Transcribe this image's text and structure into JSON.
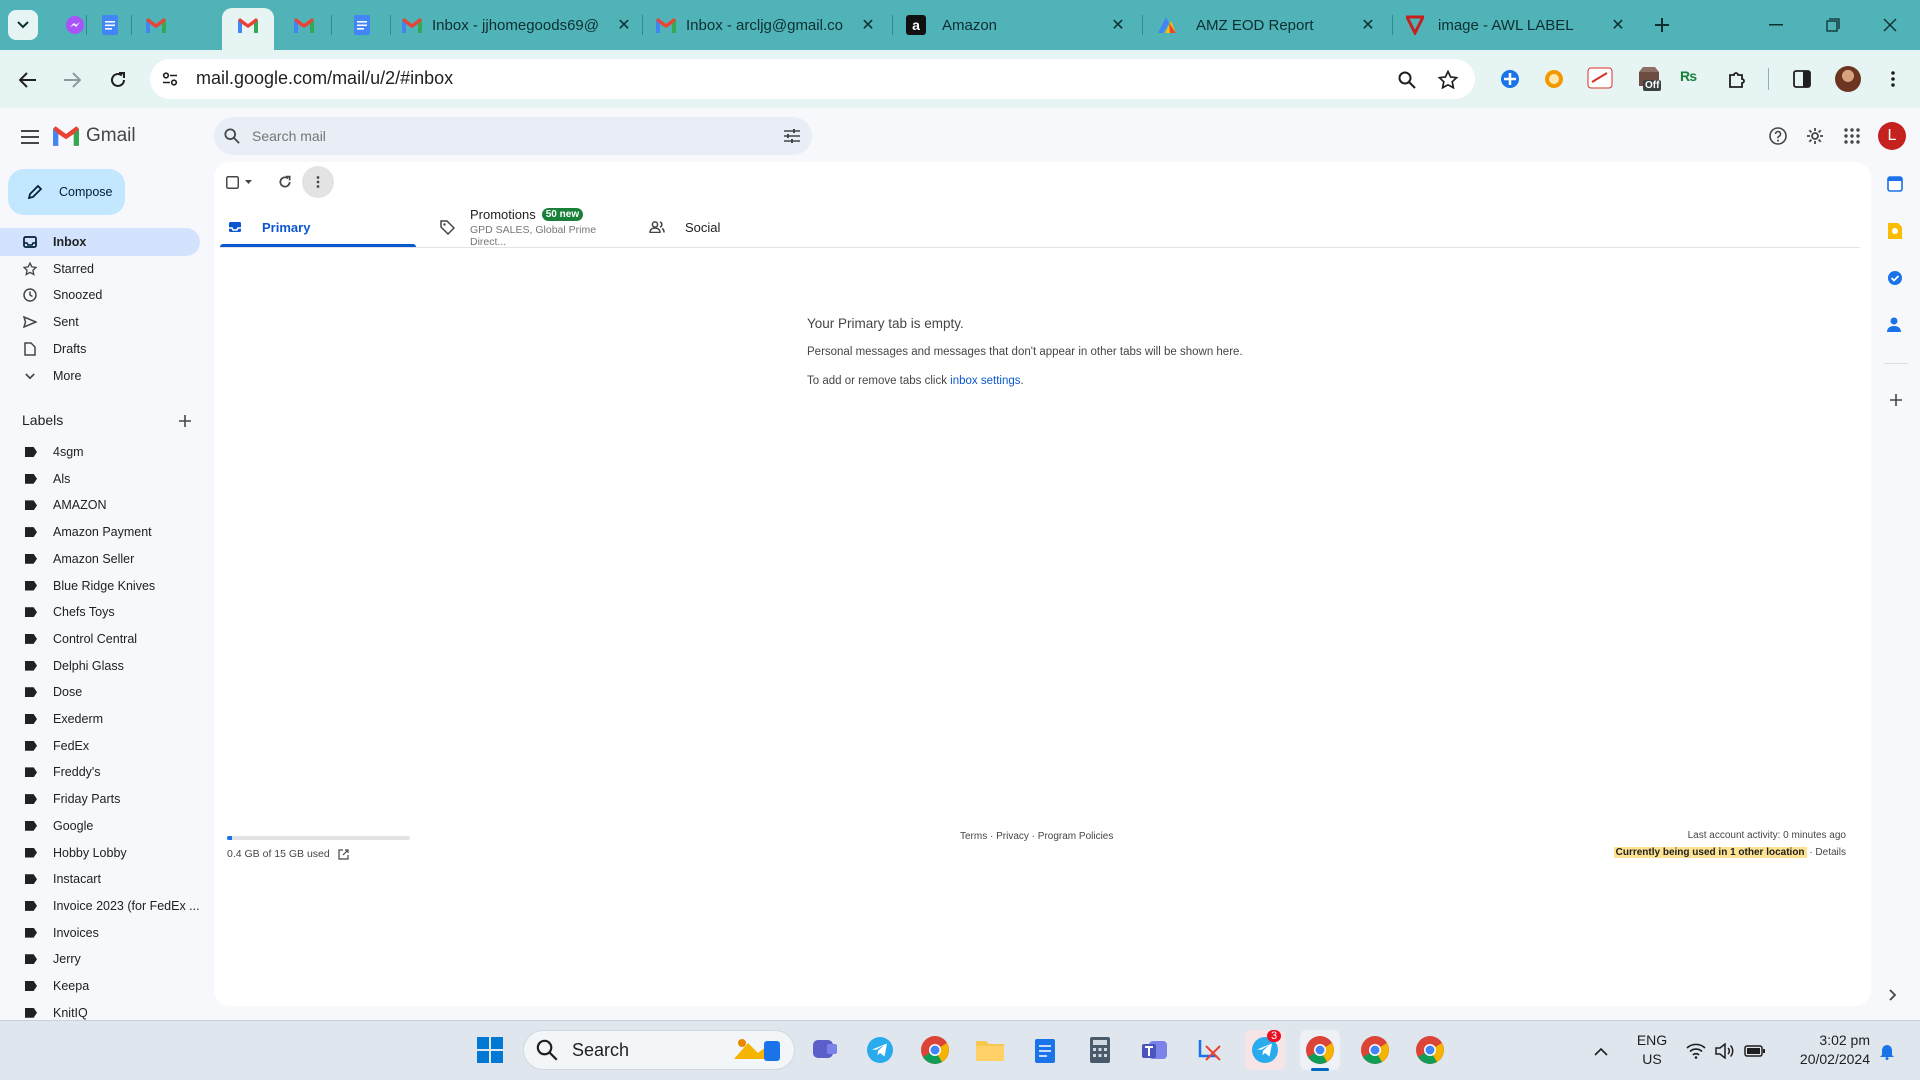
{
  "browser": {
    "tabs": [
      {
        "title": "Inbox - jjhomegoods69@",
        "icon": "gmail-icon"
      },
      {
        "title": "Inbox - arcljg@gmail.co",
        "icon": "gmail-icon"
      },
      {
        "title": "Amazon",
        "icon": "amazon-icon"
      },
      {
        "title": "AMZ EOD Report",
        "icon": "report-icon"
      },
      {
        "title": "image - AWL LABEL",
        "icon": "awl-icon"
      }
    ],
    "url": "mail.google.com/mail/u/2/#inbox",
    "extension_badge": "Off"
  },
  "gmail": {
    "app_name": "Gmail",
    "search_placeholder": "Search mail",
    "compose_label": "Compose",
    "account_initial": "L",
    "nav": [
      {
        "label": "Inbox",
        "icon": "inbox-icon"
      },
      {
        "label": "Starred",
        "icon": "star-icon"
      },
      {
        "label": "Snoozed",
        "icon": "clock-icon"
      },
      {
        "label": "Sent",
        "icon": "send-icon"
      },
      {
        "label": "Drafts",
        "icon": "draft-icon"
      },
      {
        "label": "More",
        "icon": "chevron-down-icon"
      }
    ],
    "labels_heading": "Labels",
    "labels": [
      "4sgm",
      "Als",
      "AMAZON",
      "Amazon Payment",
      "Amazon Seller",
      "Blue Ridge Knives",
      "Chefs Toys",
      "Control Central",
      "Delphi Glass",
      "Dose",
      "Exederm",
      "FedEx",
      "Freddy's",
      "Friday Parts",
      "Google",
      "Hobby Lobby",
      "Instacart",
      "Invoice 2023 (for FedEx ...",
      "Invoices",
      "Jerry",
      "Keepa",
      "KnitIQ"
    ],
    "inbox_tabs": {
      "primary": "Primary",
      "promotions": "Promotions",
      "promotions_badge": "50 new",
      "promotions_senders": "GPD SALES, Global Prime Direct...",
      "social": "Social"
    },
    "empty": {
      "title": "Your Primary tab is empty.",
      "line1": "Personal messages and messages that don't appear in other tabs will be shown here.",
      "line2_prefix": "To add or remove tabs click ",
      "line2_link": "inbox settings",
      "line2_suffix": "."
    },
    "footer": {
      "storage": "0.4 GB of 15 GB used",
      "storage_fraction": 0.027,
      "links": "Terms · Privacy · Program Policies",
      "activity": "Last account activity: 0 minutes ago",
      "location": "Currently being used in 1 other location",
      "details": " · Details"
    }
  },
  "taskbar": {
    "search_label": "Search",
    "lang_line1": "ENG",
    "lang_line2": "US",
    "time": "3:02 pm",
    "date": "20/02/2024",
    "telegram_badge": "3"
  },
  "colors": {
    "tab_strip": "#4fb3b8",
    "toolbar": "#e6f4f4",
    "gmail_bg": "#f6f8fc",
    "compose_bg": "#c2e7ff",
    "selected_nav": "#d3e3fd",
    "primary_blue": "#0b57d0",
    "badge_green": "#188038",
    "location_highlight": "#fde293"
  }
}
